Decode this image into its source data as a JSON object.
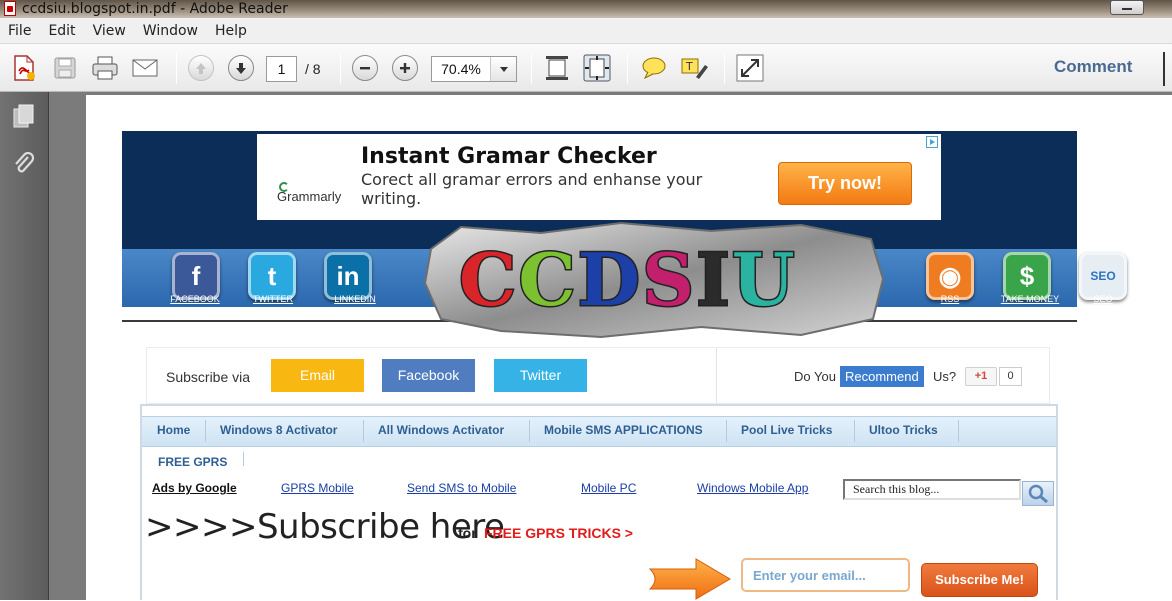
{
  "window": {
    "title": "ccdsiu.blogspot.in.pdf - Adobe Reader"
  },
  "menu": {
    "items": [
      "File",
      "Edit",
      "View",
      "Window",
      "Help"
    ]
  },
  "toolbar": {
    "page_current": "1",
    "page_total": "/ 8",
    "zoom": "70.4%",
    "comment_label": "Comment"
  },
  "page": {
    "ad": {
      "brand": "Grammarly",
      "headline": "Instant Gramar Checker",
      "body": "Corect all gramar errors and enhanse your writing.",
      "cta": "Try now!"
    },
    "social": {
      "items": [
        {
          "label": "FACEBOOK",
          "icon": "facebook-icon",
          "glyph": "f",
          "color": "#3b5998"
        },
        {
          "label": "TWITTER",
          "icon": "twitter-icon",
          "glyph": "t",
          "color": "#2aa9e0"
        },
        {
          "label": "LINKEDIN",
          "icon": "linkedin-icon",
          "glyph": "in",
          "color": "#0b6fa8"
        },
        {
          "label": "RSS",
          "icon": "rss-icon",
          "glyph": "◉",
          "color": "#f07c22"
        },
        {
          "label": "TAKE MONEY",
          "icon": "money-icon",
          "glyph": "$",
          "color": "#3aa44a"
        },
        {
          "label": "SEO",
          "icon": "seo-icon",
          "glyph": "SEO",
          "color": "#e6eef4"
        }
      ]
    },
    "logo_text": "CCDSIU",
    "subscribe": {
      "label": "Subscribe via",
      "email": "Email",
      "facebook": "Facebook",
      "twitter": "Twitter",
      "do_you": "Do You",
      "recommend": "Recommend",
      "us": "Us?",
      "gplus": "+1",
      "gplus_count": "0"
    },
    "nav": {
      "items": [
        "Home",
        "Windows 8 Activator",
        "All Windows Activator",
        "Mobile SMS APPLICATIONS",
        "Pool Live Tricks",
        "Ultoo Tricks"
      ],
      "second_row": "FREE GPRS"
    },
    "ads_row": {
      "ads_by": "Ads by Google",
      "links": [
        "GPRS Mobile",
        "Send SMS to Mobile",
        "Mobile PC",
        "Windows Mobile App"
      ],
      "search_value": "Search this blog..."
    },
    "promo": {
      "headline": ">>>>Subscribe here",
      "for": "for",
      "tricks": "FREE GPRS TRICKS >",
      "email_placeholder": "Enter your email...",
      "button": "Subscribe Me!"
    }
  }
}
